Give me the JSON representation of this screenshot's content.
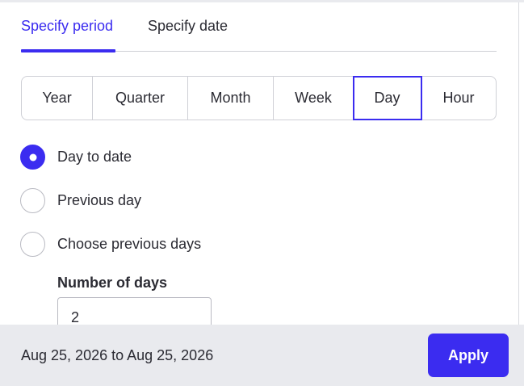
{
  "tabs": [
    {
      "label": "Specify period",
      "active": true
    },
    {
      "label": "Specify date",
      "active": false
    }
  ],
  "granularity": {
    "options": [
      "Year",
      "Quarter",
      "Month",
      "Week",
      "Day",
      "Hour"
    ],
    "selected": "Day"
  },
  "radio_options": [
    {
      "label": "Day to date",
      "checked": true
    },
    {
      "label": "Previous day",
      "checked": false
    },
    {
      "label": "Choose previous days",
      "checked": false
    }
  ],
  "number_of_days": {
    "label": "Number of days",
    "value": "2"
  },
  "footer": {
    "range_text": "Aug 25, 2026 to Aug 25, 2026",
    "apply_label": "Apply"
  },
  "colors": {
    "accent": "#3b2cf0",
    "footer_bg": "#e9eaee",
    "border": "#cfd0d6"
  }
}
